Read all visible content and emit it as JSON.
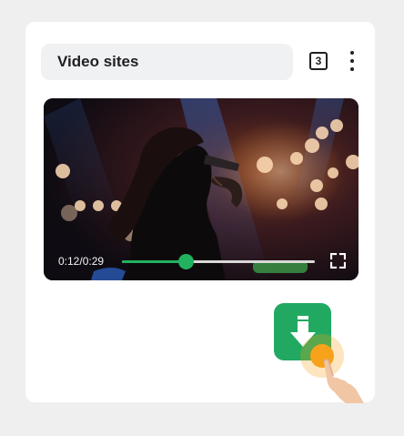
{
  "header": {
    "title": "Video sites",
    "tab_count": "3"
  },
  "video": {
    "time": "0:12/0:29",
    "progress": 0.33
  },
  "icons": {
    "menu": "more-vertical-icon",
    "fullscreen": "fullscreen-icon",
    "download": "download-icon",
    "tap": "tap-hand-icon"
  },
  "colors": {
    "accent": "#22b25f",
    "download_bg": "#21a962",
    "tap_highlight": "#f6a21a"
  }
}
